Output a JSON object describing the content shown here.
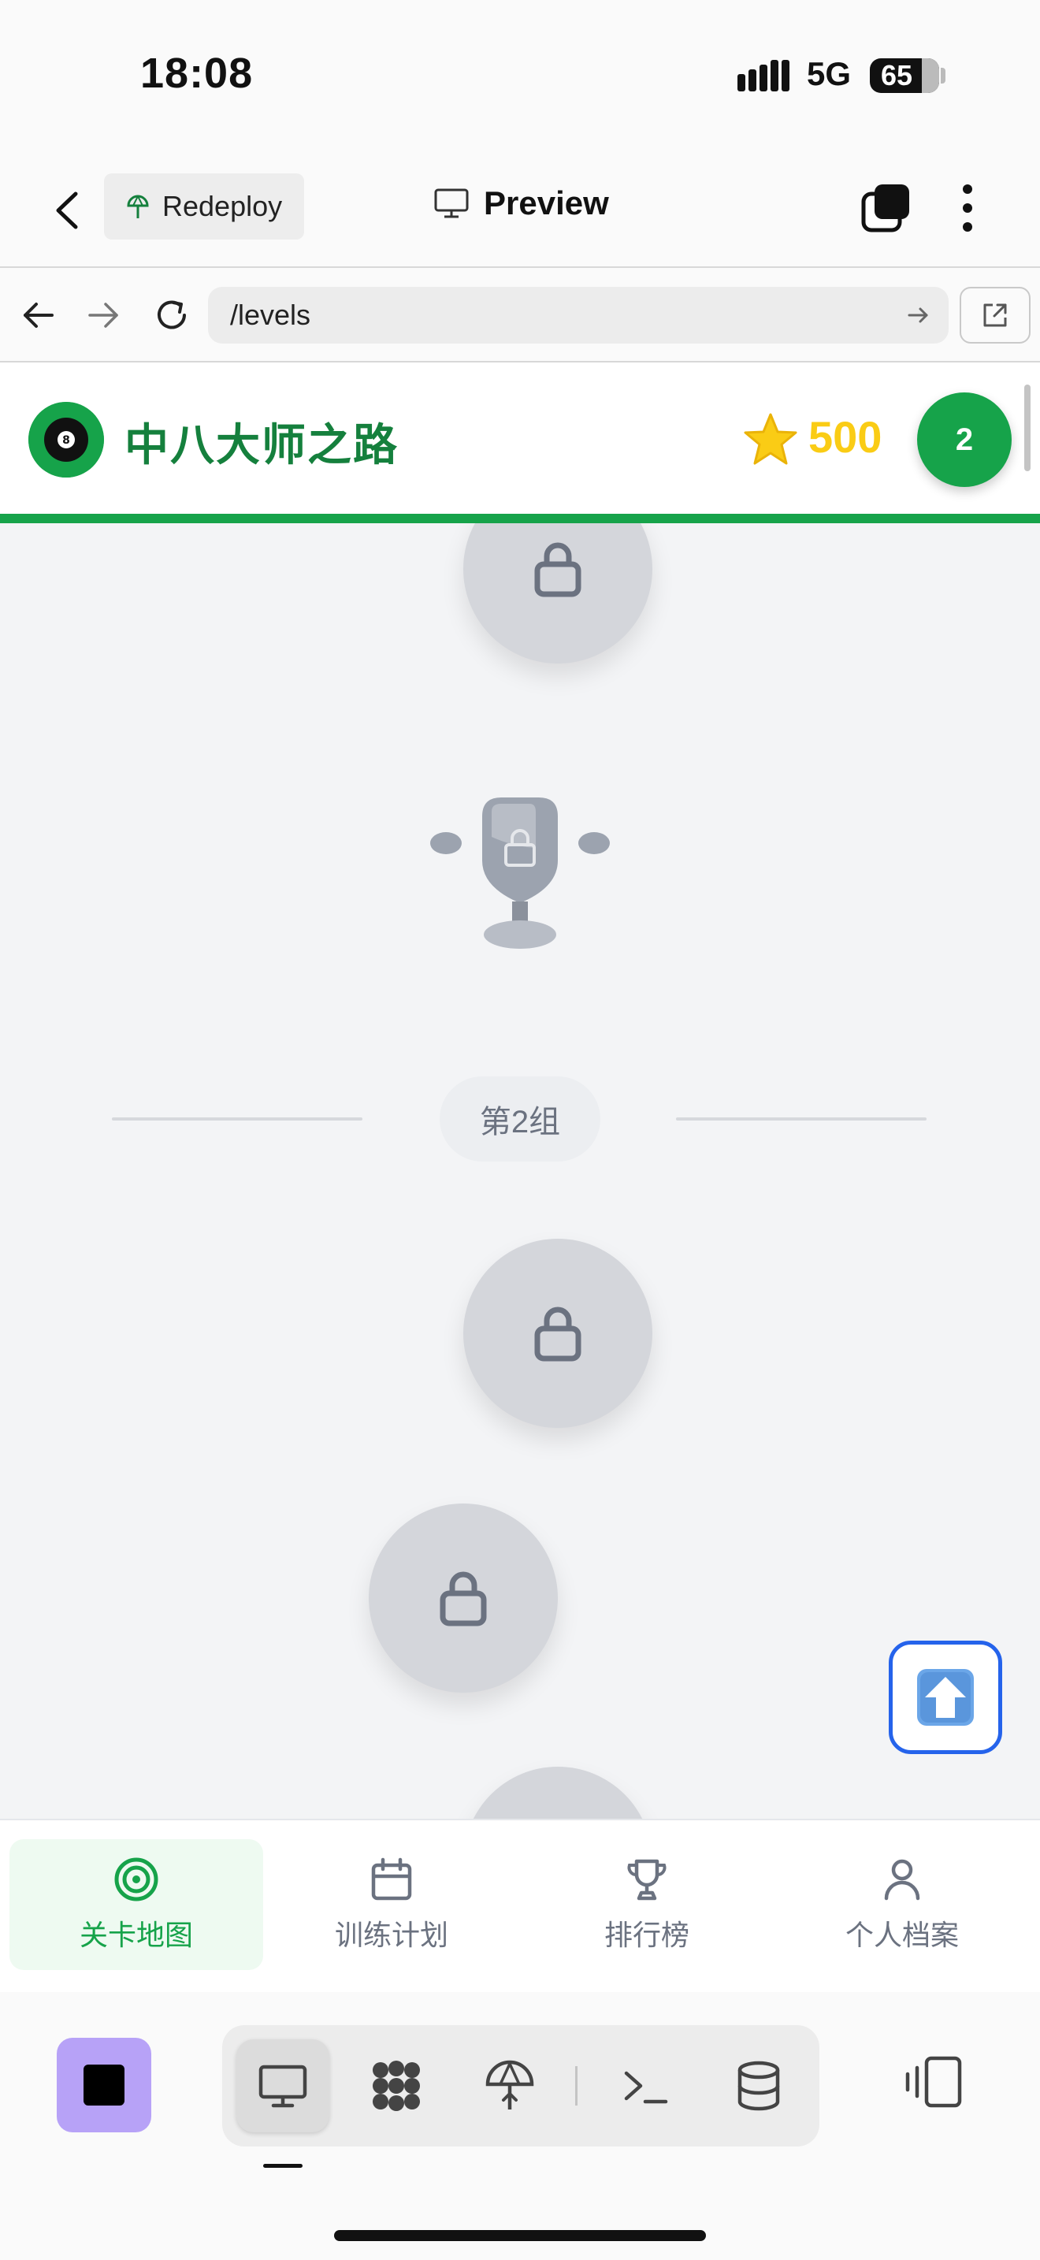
{
  "status": {
    "time": "18:08",
    "network": "5G",
    "battery": "65"
  },
  "topbar": {
    "redeploy_label": "Redeploy",
    "preview_label": "Preview"
  },
  "browser": {
    "url": "/levels"
  },
  "app": {
    "title": "中八大师之路",
    "score": "500",
    "level": "2",
    "group_label": "第2组"
  },
  "tabs": [
    {
      "label": "关卡地图",
      "icon": "target-icon",
      "active": true
    },
    {
      "label": "训练计划",
      "icon": "calendar-icon",
      "active": false
    },
    {
      "label": "排行榜",
      "icon": "trophy-icon",
      "active": false
    },
    {
      "label": "个人档案",
      "icon": "user-icon",
      "active": false
    }
  ],
  "colors": {
    "brand_green": "#16a34a",
    "star_yellow": "#facc15",
    "locked_node": "#d4d6db",
    "scroll_top_border": "#2563eb",
    "stop_button": "#b7a2f7"
  },
  "toolbar": {
    "tools": [
      "monitor-icon",
      "grid-blob-icon",
      "deploy-icon",
      "terminal-icon",
      "database-icon"
    ]
  }
}
